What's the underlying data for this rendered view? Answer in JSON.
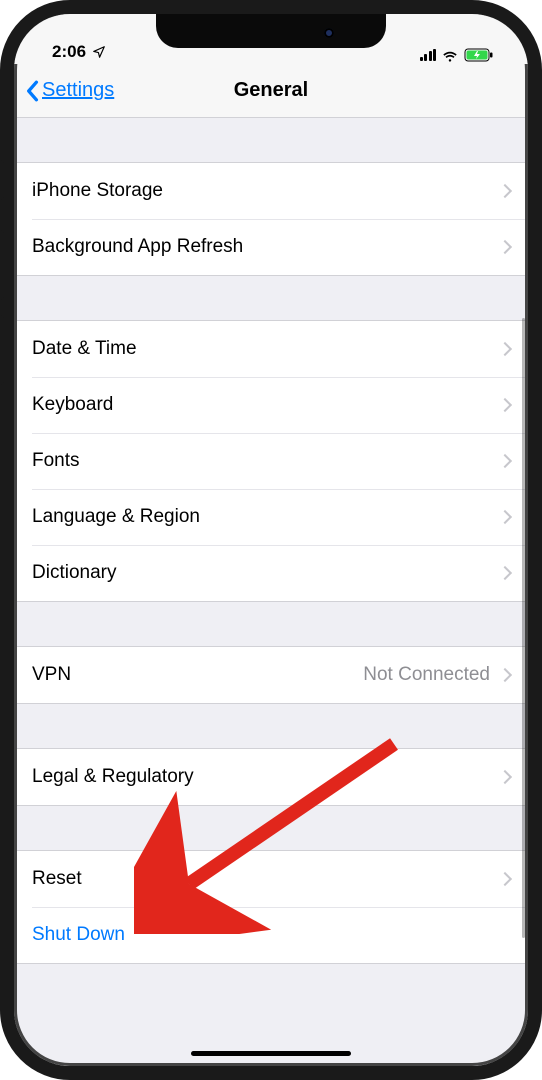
{
  "status": {
    "time": "2:06",
    "location_icon": "location-arrow"
  },
  "nav": {
    "back_label": "Settings",
    "title": "General"
  },
  "groups": [
    {
      "id": "storage",
      "rows": [
        {
          "id": "iphone-storage",
          "label": "iPhone Storage",
          "disclosure": true
        },
        {
          "id": "background-refresh",
          "label": "Background App Refresh",
          "disclosure": true
        }
      ]
    },
    {
      "id": "input",
      "rows": [
        {
          "id": "date-time",
          "label": "Date & Time",
          "disclosure": true
        },
        {
          "id": "keyboard",
          "label": "Keyboard",
          "disclosure": true
        },
        {
          "id": "fonts",
          "label": "Fonts",
          "disclosure": true
        },
        {
          "id": "language-region",
          "label": "Language & Region",
          "disclosure": true
        },
        {
          "id": "dictionary",
          "label": "Dictionary",
          "disclosure": true
        }
      ]
    },
    {
      "id": "vpn",
      "rows": [
        {
          "id": "vpn",
          "label": "VPN",
          "value": "Not Connected",
          "disclosure": true
        }
      ]
    },
    {
      "id": "legal",
      "rows": [
        {
          "id": "legal-regulatory",
          "label": "Legal & Regulatory",
          "disclosure": true
        }
      ]
    },
    {
      "id": "reset",
      "rows": [
        {
          "id": "reset",
          "label": "Reset",
          "disclosure": true
        },
        {
          "id": "shut-down",
          "label": "Shut Down",
          "link": true
        }
      ]
    }
  ],
  "annotation": {
    "arrow_target": "reset"
  }
}
